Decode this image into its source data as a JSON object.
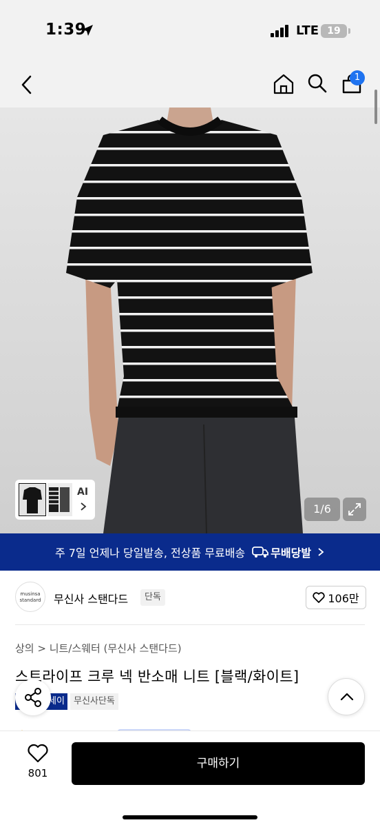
{
  "status": {
    "time": "1:39",
    "network": "LTE",
    "battery": "19"
  },
  "nav": {
    "cart_count": "1"
  },
  "gallery": {
    "thumb_label": "AI",
    "counter": "1/6"
  },
  "banner": {
    "text": "주 7일 언제나 당일발송, 전상품 무료배송",
    "logo_text": "무배당발"
  },
  "brand": {
    "logo_text": "musinsa standard",
    "name": "무신사 스탠다드",
    "tag": "단독",
    "likes": "106만"
  },
  "product": {
    "breadcrumb": "상의 > 니트/스웨터 (무신사 스탠다드)",
    "title": "스트라이프 크루 넥 반소매 니트 [블랙/화이트]",
    "badge_dark": "세이",
    "badge_light": "무신사단독"
  },
  "bottom": {
    "wish_count": "801",
    "buy_label": "구매하기"
  },
  "colors": {
    "banner_blue": "#0a2b8c",
    "badge_blue": "#0a2b8c",
    "cart_badge": "#1f73f0"
  }
}
